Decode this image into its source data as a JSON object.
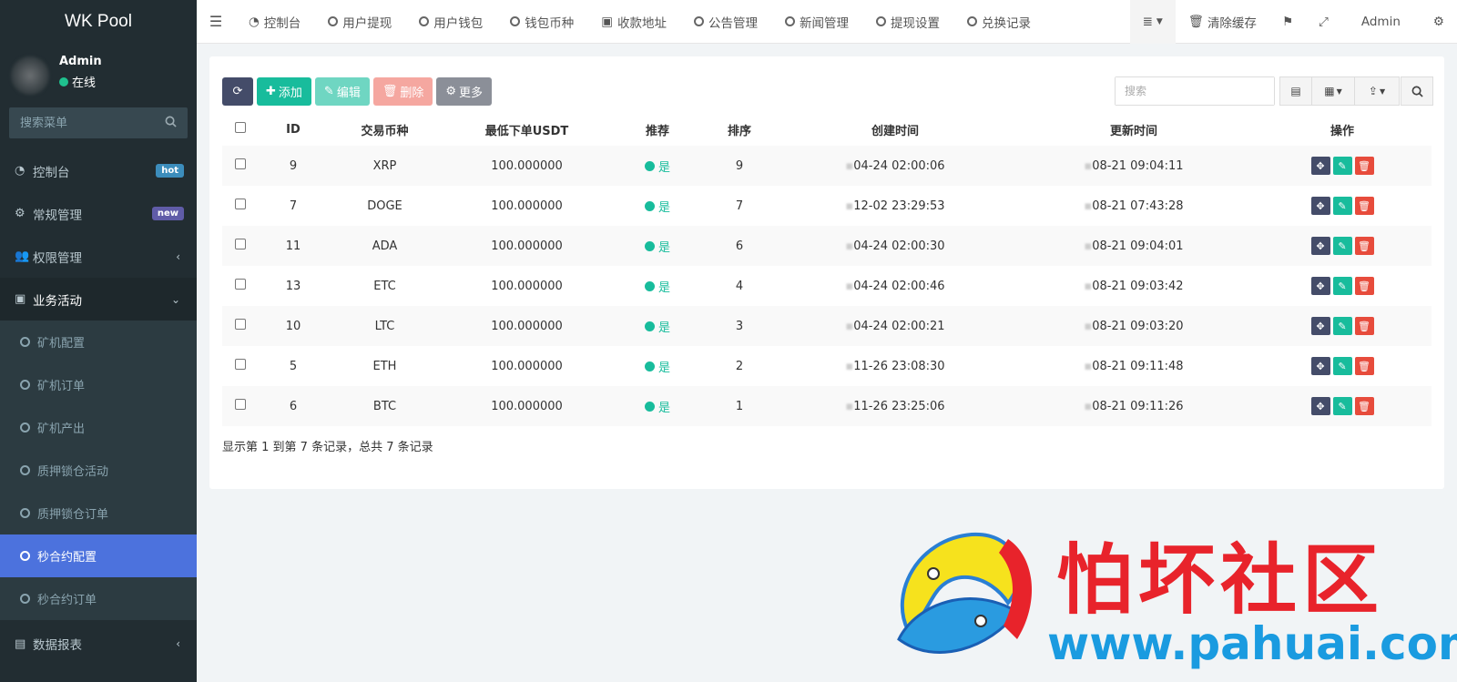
{
  "brand": "WK Pool",
  "user": {
    "name": "Admin",
    "status": "在线"
  },
  "sidebar": {
    "search_placeholder": "搜索菜单",
    "items": [
      {
        "label": "控制台",
        "badge": "hot"
      },
      {
        "label": "常规管理",
        "badge": "new"
      },
      {
        "label": "权限管理"
      },
      {
        "label": "业务活动"
      }
    ],
    "sub_items": [
      "矿机配置",
      "矿机订单",
      "矿机产出",
      "质押锁仓活动",
      "质押锁仓订单",
      "秒合约配置",
      "秒合约订单"
    ],
    "bottom_item": "数据报表",
    "active": "秒合约配置"
  },
  "topbar": {
    "tabs": [
      "控制台",
      "用户提现",
      "用户钱包",
      "钱包币种",
      "收款地址",
      "公告管理",
      "新闻管理",
      "提现设置",
      "兑换记录"
    ],
    "clear_cache": "清除缓存",
    "admin": "Admin"
  },
  "toolbar": {
    "add": "添加",
    "edit": "编辑",
    "delete": "删除",
    "more": "更多"
  },
  "search": {
    "placeholder": "搜索"
  },
  "table": {
    "headers": [
      "ID",
      "交易币种",
      "最低下单USDT",
      "推荐",
      "排序",
      "创建时间",
      "更新时间",
      "操作"
    ],
    "rows": [
      {
        "id": "9",
        "coin": "XRP",
        "min": "100.000000",
        "rec": "是",
        "sort": "9",
        "created": "04-24 02:00:06",
        "updated": "08-21 09:04:11"
      },
      {
        "id": "7",
        "coin": "DOGE",
        "min": "100.000000",
        "rec": "是",
        "sort": "7",
        "created": "12-02 23:29:53",
        "updated": "08-21 07:43:28"
      },
      {
        "id": "11",
        "coin": "ADA",
        "min": "100.000000",
        "rec": "是",
        "sort": "6",
        "created": "04-24 02:00:30",
        "updated": "08-21 09:04:01"
      },
      {
        "id": "13",
        "coin": "ETC",
        "min": "100.000000",
        "rec": "是",
        "sort": "4",
        "created": "04-24 02:00:46",
        "updated": "08-21 09:03:42"
      },
      {
        "id": "10",
        "coin": "LTC",
        "min": "100.000000",
        "rec": "是",
        "sort": "3",
        "created": "04-24 02:00:21",
        "updated": "08-21 09:03:20"
      },
      {
        "id": "5",
        "coin": "ETH",
        "min": "100.000000",
        "rec": "是",
        "sort": "2",
        "created": "11-26 23:08:30",
        "updated": "08-21 09:11:48"
      },
      {
        "id": "6",
        "coin": "BTC",
        "min": "100.000000",
        "rec": "是",
        "sort": "1",
        "created": "11-26 23:25:06",
        "updated": "08-21 09:11:26"
      }
    ]
  },
  "pagination": "显示第 1 到第 7 条记录，总共 7 条记录",
  "watermark": {
    "title": "怕坏社区",
    "url": "www.pahuai.com"
  },
  "colors": {
    "accent": "#4c72dd",
    "green": "#18bc9c",
    "sidebar": "#222d32",
    "danger": "#e74c3c"
  }
}
